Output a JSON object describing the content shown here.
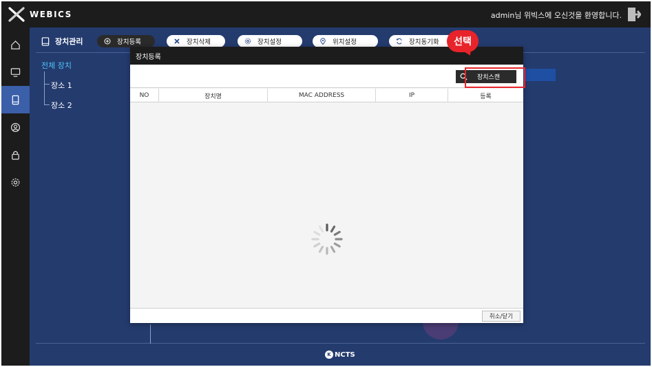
{
  "app": {
    "logo_text": "WEBICS",
    "welcome": "admin님 위빅스에 오신것을 환영합니다."
  },
  "rail": {
    "items": [
      {
        "icon": "home-icon"
      },
      {
        "icon": "monitor-icon"
      },
      {
        "icon": "device-icon"
      },
      {
        "icon": "user-icon"
      },
      {
        "icon": "lock-icon"
      },
      {
        "icon": "gear-icon"
      }
    ]
  },
  "toolbar": {
    "title": "장치관리",
    "buttons": [
      {
        "label": "장치등록",
        "icon": "plus-circle-icon"
      },
      {
        "label": "장치삭제",
        "icon": "x-icon"
      },
      {
        "label": "장치설정",
        "icon": "settings-icon"
      },
      {
        "label": "위치설정",
        "icon": "location-pin-icon"
      },
      {
        "label": "장치동기화",
        "icon": "sync-icon"
      }
    ]
  },
  "tree": {
    "root": "전체 장치",
    "children": [
      "장소 1",
      "장소 2"
    ]
  },
  "modal": {
    "title": "장치등록",
    "scan_button": "장치스캔",
    "columns": [
      "NO",
      "장치명",
      "MAC ADDRESS",
      "IP",
      "등록"
    ],
    "cancel_button": "취소/닫기"
  },
  "annotation": {
    "callout_text": "선택",
    "color": "#e8232a"
  },
  "footer": {
    "mark": "K",
    "logo_text": "NCTS"
  },
  "colors": {
    "background": "#243b6e",
    "chrome": "#1c1c1c",
    "accent": "#4fc3f7",
    "active": "#3b5fa8"
  }
}
